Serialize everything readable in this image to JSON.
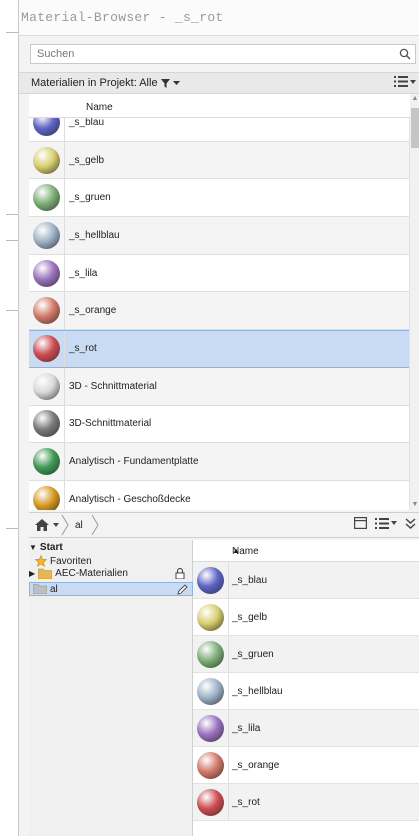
{
  "window": {
    "title": "Material-Browser - _s_rot"
  },
  "search": {
    "placeholder": "Suchen"
  },
  "filter": {
    "label": "Materialien in Projekt: Alle"
  },
  "project_list": {
    "column_name": "Name",
    "items": [
      {
        "label": "_s_blau",
        "color": "#5e63c8"
      },
      {
        "label": "_s_gelb",
        "color": "#d8cf6f"
      },
      {
        "label": "_s_gruen",
        "color": "#7fb078"
      },
      {
        "label": "_s_hellblau",
        "color": "#9fb3c8"
      },
      {
        "label": "_s_lila",
        "color": "#9a73bf"
      },
      {
        "label": "_s_orange",
        "color": "#d47a6a"
      },
      {
        "label": "_s_rot",
        "color": "#d04c52",
        "selected": true
      },
      {
        "label": "3D - Schnittmaterial",
        "color": "#d9d9d9"
      },
      {
        "label": "3D-Schnittmaterial",
        "color": "#7a7a7a"
      },
      {
        "label": "Analytisch - Fundamentplatte",
        "color": "#3f9a55"
      },
      {
        "label": "Analytisch - Geschoßdecke",
        "color": "#d99a1e"
      }
    ]
  },
  "breadcrumb": {
    "current": "al"
  },
  "tree": {
    "root": "Start",
    "favorites": "Favoriten",
    "aec": "AEC-Materialien",
    "al": "al"
  },
  "library_list": {
    "column_name": "Name",
    "items": [
      {
        "label": "_s_blau",
        "color": "#5e63c8"
      },
      {
        "label": "_s_gelb",
        "color": "#d8cf6f"
      },
      {
        "label": "_s_gruen",
        "color": "#7fb078"
      },
      {
        "label": "_s_hellblau",
        "color": "#9fb3c8"
      },
      {
        "label": "_s_lila",
        "color": "#9a73bf"
      },
      {
        "label": "_s_orange",
        "color": "#d47a6a"
      },
      {
        "label": "_s_rot",
        "color": "#d04c52"
      }
    ]
  },
  "colors": {
    "selection": "#c9dbf2",
    "selection_border": "#8fb3df"
  }
}
